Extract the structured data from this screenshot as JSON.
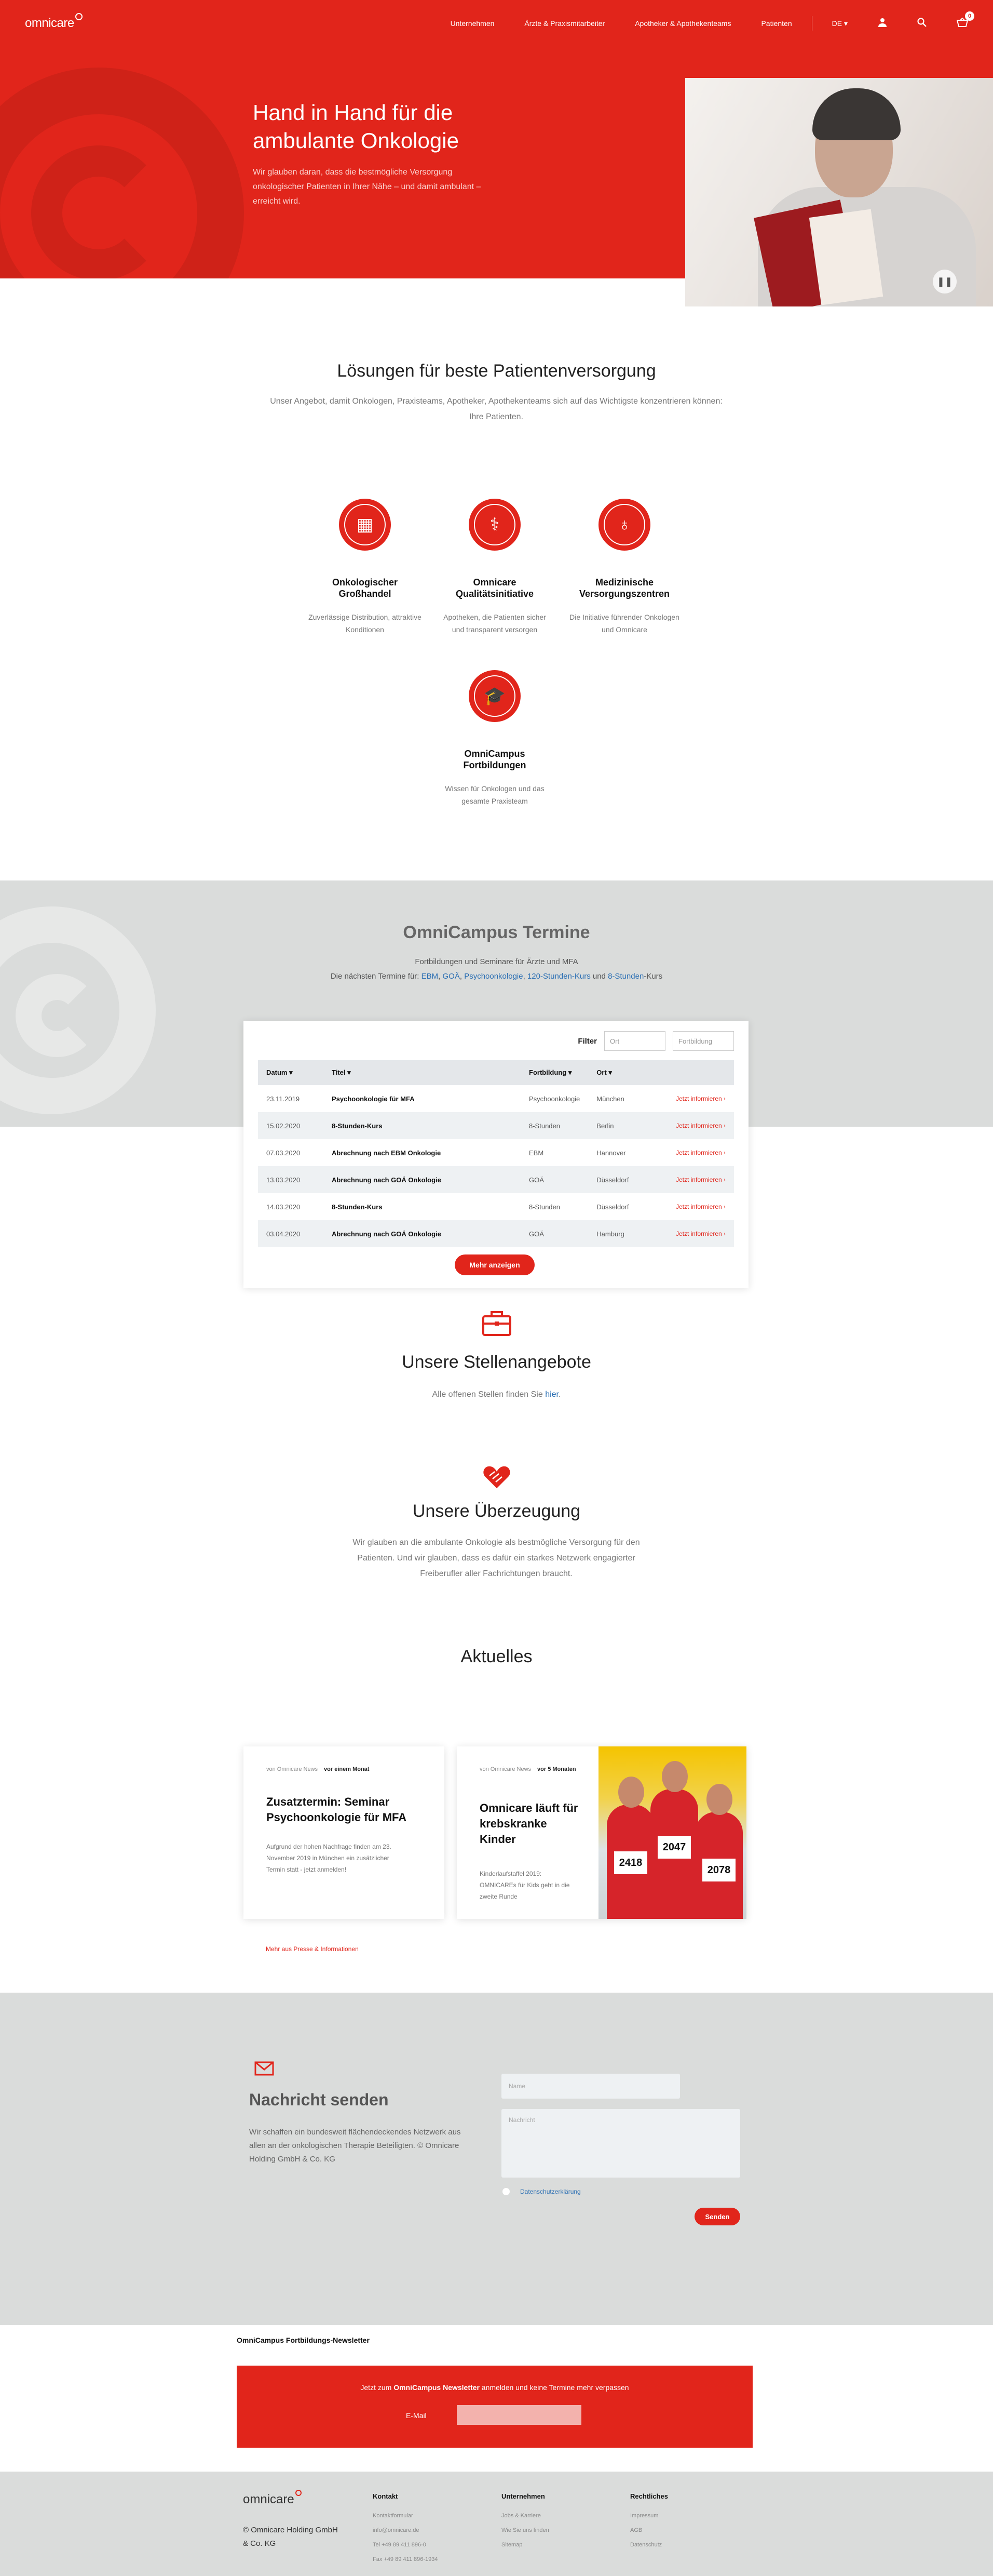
{
  "header": {
    "logo": "omnicare",
    "nav": [
      "Unternehmen",
      "Ärzte & Praxismitarbeiter",
      "Apotheker & Apothekenteams",
      "Patienten"
    ],
    "language": "DE",
    "cart_count": "0"
  },
  "hero": {
    "title": "Hand in Hand für die ambulante Onkologie",
    "text": "Wir glauben daran, dass die bestmögliche Versorgung onkologischer Patienten in Ihrer Nähe – und damit ambulant – erreicht wird."
  },
  "solutions": {
    "title": "Lösungen für beste Patientenversorgung",
    "subtitle": "Unser Angebot, damit Onkologen, Praxisteams, Apotheker, Apothekenteams sich auf das Wichtigste konzentrieren können: Ihre Patienten.",
    "items": [
      {
        "title": "Onkologischer Großhandel",
        "text": "Zuverlässige Distribution, attraktive Konditionen"
      },
      {
        "title": "Omnicare Qualitätsinitiative",
        "text": "Apotheken, die Patienten sicher und transparent versorgen"
      },
      {
        "title": "Medizinische Versorgungszentren",
        "text": "Die Initiative führender Onkologen und Omnicare"
      },
      {
        "title": "OmniCampus Fortbildungen",
        "text": "Wissen für Onkologen und das gesamte Praxisteam"
      }
    ]
  },
  "campus": {
    "title": "OmniCampus Termine",
    "line1": "Fortbildungen und Seminare für Ärzte und MFA",
    "line2_prefix": "Die nächsten Termine für:",
    "links": [
      "EBM",
      "GOÄ",
      "Psychoonkologie",
      "120-Stunden-Kurs",
      "8-Stunden"
    ],
    "line2_suffix": "-Kurs",
    "filter_label": "Filter",
    "filter_ort": "Ort",
    "filter_fortbildung": "Fortbildung",
    "columns": [
      "Datum",
      "Titel",
      "Fortbildung",
      "Ort"
    ],
    "rows": [
      {
        "datum": "23.11.2019",
        "titel": "Psychoonkologie für MFA",
        "fortbildung": "Psychoonkologie",
        "ort": "München",
        "more": "Jetzt informieren ›"
      },
      {
        "datum": "15.02.2020",
        "titel": "8-Stunden-Kurs",
        "fortbildung": "8-Stunden",
        "ort": "Berlin",
        "more": "Jetzt informieren ›"
      },
      {
        "datum": "07.03.2020",
        "titel": "Abrechnung nach EBM Onkologie",
        "fortbildung": "EBM",
        "ort": "Hannover",
        "more": "Jetzt informieren ›"
      },
      {
        "datum": "13.03.2020",
        "titel": "Abrechnung nach GOÄ Onkologie",
        "fortbildung": "GOÄ",
        "ort": "Düsseldorf",
        "more": "Jetzt informieren ›"
      },
      {
        "datum": "14.03.2020",
        "titel": "8-Stunden-Kurs",
        "fortbildung": "8-Stunden",
        "ort": "Düsseldorf",
        "more": "Jetzt informieren ›"
      },
      {
        "datum": "03.04.2020",
        "titel": "Abrechnung nach GOÄ Onkologie",
        "fortbildung": "GOÄ",
        "ort": "Hamburg",
        "more": "Jetzt informieren ›"
      }
    ],
    "more_button": "Mehr anzeigen"
  },
  "jobs": {
    "title": "Unsere Stellenangebote",
    "text": "Alle offenen Stellen finden Sie",
    "link": "hier",
    "end": "."
  },
  "belief": {
    "title": "Unsere Überzeugung",
    "text": "Wir glauben an die ambulante Onkologie als bestmögliche Versorgung für den Patienten. Und wir glauben, dass es dafür ein starkes Netzwerk engagierter Freiberufler aller Fachrichtungen braucht."
  },
  "news": {
    "title": "Aktuelles",
    "cards": [
      {
        "source": "von Omnicare News",
        "time": "vor einem Monat",
        "title": "Zusatztermin: Seminar Psychoonkologie für MFA",
        "text": "Aufgrund der hohen Nachfrage finden am 23. November 2019 in München ein zusätzlicher Termin statt - jetzt anmelden!"
      },
      {
        "source": "von Omnicare News",
        "time": "vor 5 Monaten",
        "title": "Omnicare läuft für krebskranke Kinder",
        "text": "Kinderlaufstaffel 2019: OMNICAREs für Kids geht in die zweite Runde"
      }
    ],
    "bibs": [
      "2418",
      "2047",
      "2078"
    ],
    "more_link": "Mehr aus Presse & Informationen"
  },
  "contact": {
    "title": "Nachricht senden",
    "text": "Wir schaffen ein bundesweit flächendeckendes Netzwerk aus allen an der onkologischen Therapie Beteiligten. © Omnicare Holding GmbH & Co. KG",
    "name_placeholder": "Name",
    "message_placeholder": "Nachricht",
    "privacy": "Datenschutzerklärung",
    "send": "Senden"
  },
  "newsletter": {
    "title": "OmniCampus Fortbildungs-Newsletter",
    "text_prefix": "Jetzt zum ",
    "text_bold": "OmniCampus Newsletter",
    "text_suffix": " anmelden und keine Termine mehr verpassen",
    "email_label": "E-Mail"
  },
  "footer": {
    "logo": "omnicare",
    "copyright": "© Omnicare Holding GmbH & Co. KG",
    "columns": [
      {
        "title": "Kontakt",
        "items": [
          "Kontaktformular",
          "info@omnicare.de",
          "Tel +49 89 411 896-0",
          "Fax +49 89 411 896-1934"
        ]
      },
      {
        "title": "Unternehmen",
        "items": [
          "Jobs & Karriere",
          "Wie Sie uns finden",
          "Sitemap"
        ]
      },
      {
        "title": "Rechtliches",
        "items": [
          "Impressum",
          "AGB",
          "Datenschutz"
        ]
      }
    ]
  },
  "colors": {
    "brand_red": "#e1251b",
    "grey_bg": "#dadcdb",
    "link_blue": "#2b6fb3"
  }
}
